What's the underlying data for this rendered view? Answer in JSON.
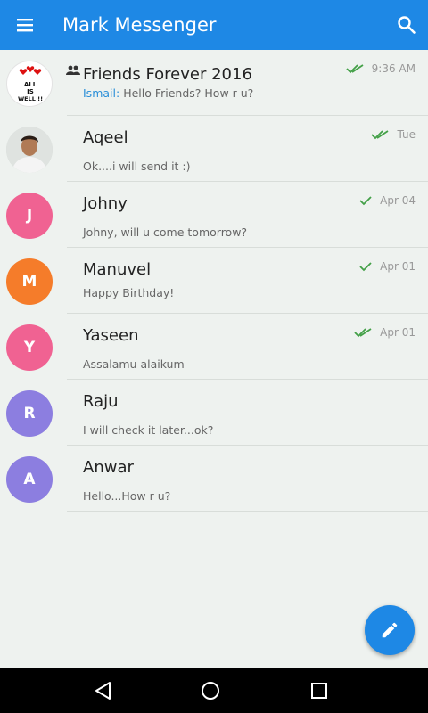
{
  "appbar": {
    "title": "Mark Messenger",
    "bg_color": "#1e88e5",
    "menu_icon": "menu-icon",
    "search_icon": "search-icon"
  },
  "conversations": [
    {
      "name": "Friends Forever 2016",
      "is_group": true,
      "sender": "Ismail:",
      "message": "Hello Friends? How r u?",
      "time": "9:36 AM",
      "ticks": "double",
      "avatar_type": "image",
      "avatar_text": "ALL IS WELL !!"
    },
    {
      "name": "Aqeel",
      "message": "Ok....i will send it :)",
      "time": "Tue",
      "ticks": "double",
      "avatar_type": "photo"
    },
    {
      "name": "Johny",
      "message": "Johny, will u come tomorrow?",
      "time": "Apr 04",
      "ticks": "single",
      "avatar_type": "letter",
      "initial": "J",
      "color": "#f06292"
    },
    {
      "name": "Manuvel",
      "message": "Happy Birthday!",
      "time": "Apr 01",
      "ticks": "single",
      "avatar_type": "letter",
      "initial": "M",
      "color": "#f57c2a"
    },
    {
      "name": "Yaseen",
      "message": "Assalamu alaikum",
      "time": "Apr 01",
      "ticks": "double",
      "avatar_type": "letter",
      "initial": "Y",
      "color": "#f06292"
    },
    {
      "name": "Raju",
      "message": "I will check it later...ok?",
      "time": "",
      "ticks": "none",
      "avatar_type": "letter",
      "initial": "R",
      "color": "#8c7ee0"
    },
    {
      "name": "Anwar",
      "message": "Hello...How r u?",
      "time": "",
      "ticks": "none",
      "avatar_type": "letter",
      "initial": "A",
      "color": "#8c7ee0"
    }
  ],
  "fab": {
    "icon": "pencil-icon"
  },
  "navbar": {
    "back_icon": "back-icon",
    "home_icon": "home-icon",
    "recents_icon": "recents-icon"
  }
}
